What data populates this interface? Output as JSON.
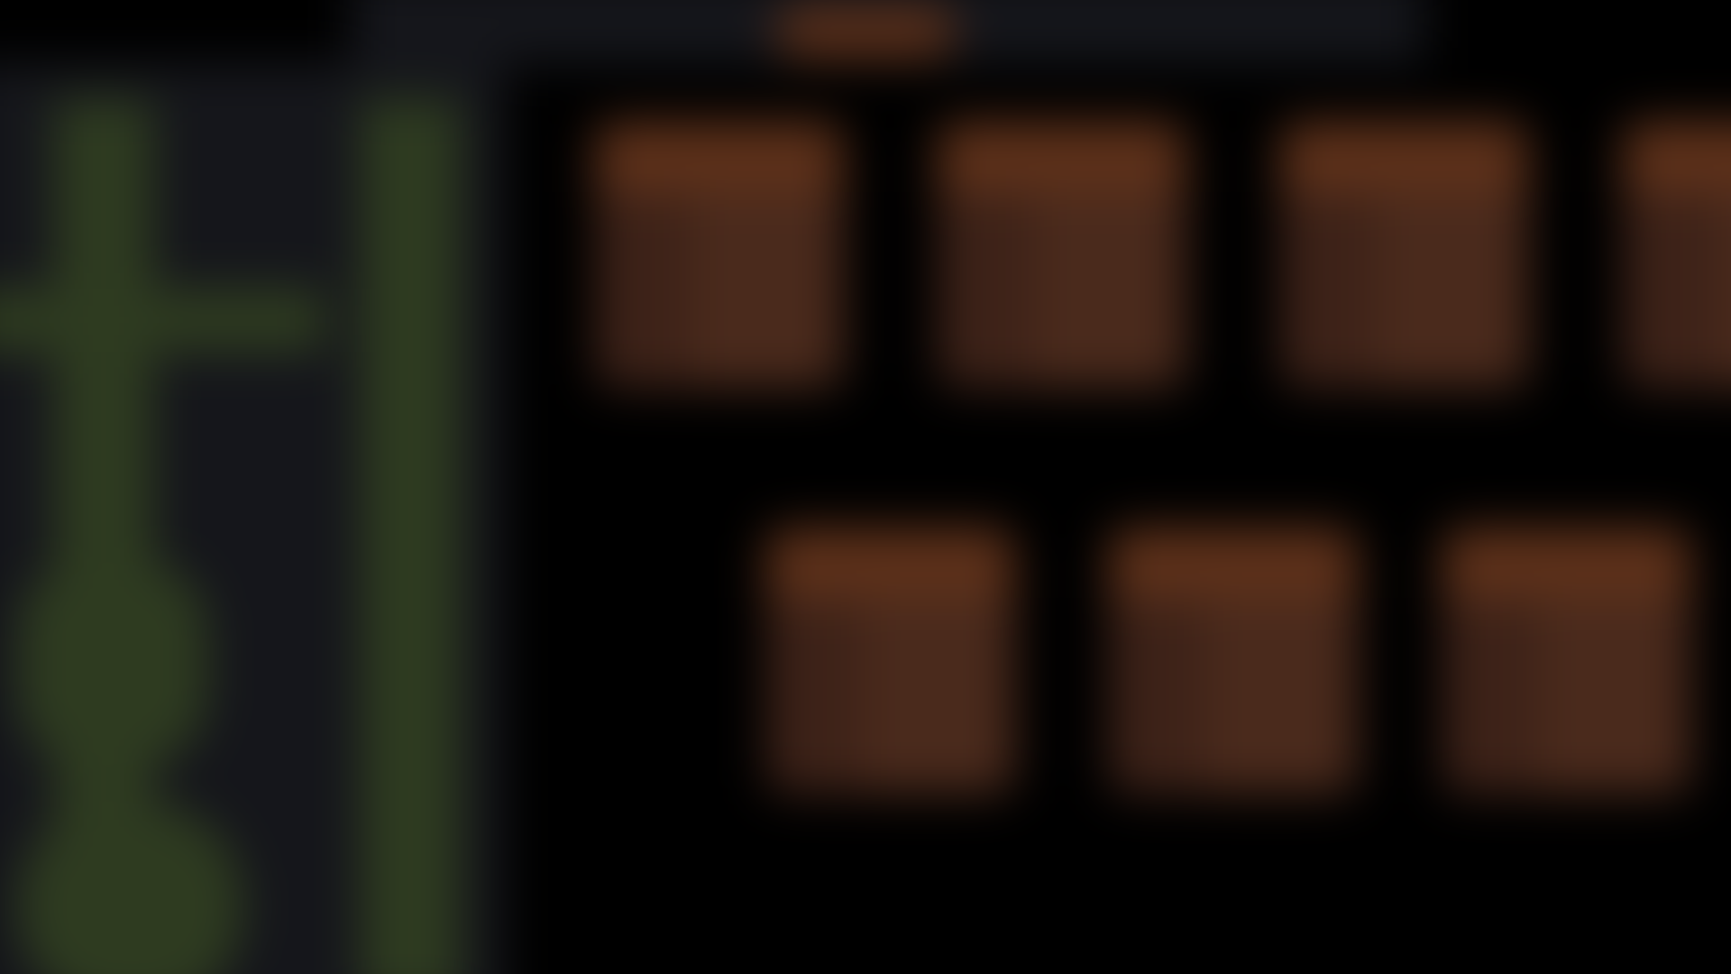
{
  "screen": {
    "background": "#000000",
    "panel_color": "#15161b",
    "accent_color": "#5a2f1a",
    "green_color": "#2e3b20",
    "slot_color": "#4a2a1c"
  },
  "top_bar": {
    "accent_icon": "tab-indicator-icon"
  },
  "left_panel": {
    "icon": "tree-structure-icon"
  },
  "grid": {
    "rows": [
      {
        "slots": [
          {
            "icon": "tile-icon"
          },
          {
            "icon": "tile-icon"
          },
          {
            "icon": "tile-icon"
          },
          {
            "icon": "tile-icon"
          }
        ]
      },
      {
        "slots": [
          {
            "icon": "tile-icon"
          },
          {
            "icon": "tile-icon"
          },
          {
            "icon": "tile-icon"
          }
        ]
      }
    ]
  }
}
